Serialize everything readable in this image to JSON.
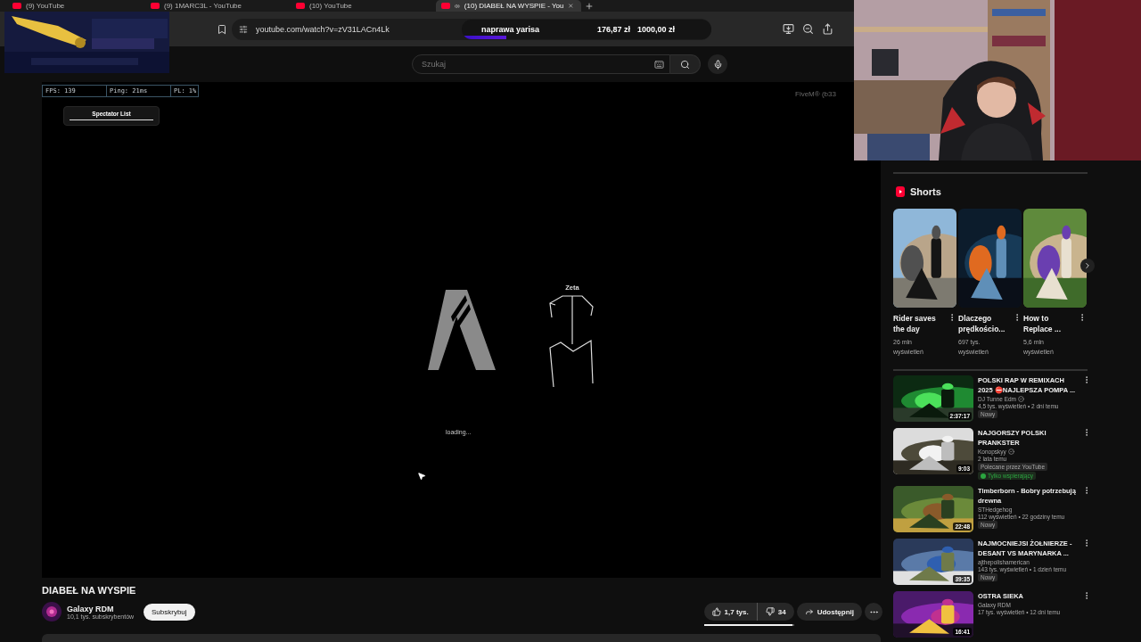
{
  "browser": {
    "tabs": [
      {
        "title": "(9) YouTube",
        "selected": false,
        "audio": false
      },
      {
        "title": "(9) 1MARC3L - YouTube",
        "selected": false,
        "audio": false
      },
      {
        "title": "(10) YouTube",
        "selected": false,
        "audio": false
      },
      {
        "title": "(10) DIABEŁ NA WYSPIE - You",
        "selected": true,
        "audio": true
      }
    ],
    "address": "youtube.com/watch?v=zV31LACn4Lk"
  },
  "stream_goal": {
    "label": "naprawa yarisa",
    "level": 0.18,
    "raised": "176,87 zł",
    "target": "1000,00 zł"
  },
  "search": {
    "placeholder": "Szukaj"
  },
  "player": {
    "hud": [
      "FPS: 139",
      "Ping: 21ms",
      "PL: 1%"
    ],
    "spectator_title": "Spectator List",
    "version": "FiveM® (b33",
    "player_tag": "Zeta",
    "status": "loading..."
  },
  "video": {
    "title": "DIABEŁ NA WYSPIE",
    "channel": "Galaxy RDM",
    "subscribers": "10,1 tys. subskrybentów",
    "subscribe": "Subskrybuj",
    "likes": "1,7 tys.",
    "dislikes": "34",
    "share": "Udostępnij",
    "rating_bar": {
      "level": 0.98
    }
  },
  "shorts": {
    "heading": "Shorts",
    "items": [
      {
        "title": "Rider saves the day",
        "views": "26 mln wyświetleń"
      },
      {
        "title": "Dlaczego prędkościo...",
        "views": "697 tys. wyświetleń"
      },
      {
        "title": "How to Replace ...",
        "views": "5,6 mln wyświetleń"
      }
    ]
  },
  "recommended": [
    {
      "title": "POLSKI RAP W REMIXACH 2025 ⛔NAJLEPSZA POMPA ...",
      "channel": "DJ Tunne Edm",
      "verified": true,
      "meta": "4,5 tys. wyświetleń • 2 dni temu",
      "badges": [
        {
          "text": "Nowy",
          "kind": "label"
        }
      ],
      "duration": "2:37:17"
    },
    {
      "title": "NAJGORSZY POLSKI PRANKSTER",
      "channel": "Konopskyy",
      "verified": true,
      "meta": "2 lata temu",
      "badges": [
        {
          "text": "Polecane przez YouTube",
          "kind": "label"
        },
        {
          "text": "Tylko wspierający",
          "kind": "members"
        }
      ],
      "duration": "9:03"
    },
    {
      "title": "Timberborn - Bobry potrzebują drewna",
      "channel": "STHedgehog",
      "verified": false,
      "meta": "112 wyświetleń • 22 godziny temu",
      "badges": [
        {
          "text": "Nowy",
          "kind": "label"
        }
      ],
      "duration": "22:48"
    },
    {
      "title": "NAJMOCNIEJSI ŻOŁNIERZE - DESANT VS MARYNARKA ...",
      "channel": "ajthepolishamerican",
      "verified": false,
      "meta": "143 tys. wyświetleń • 1 dzień temu",
      "badges": [
        {
          "text": "Nowy",
          "kind": "label"
        }
      ],
      "duration": "39:35"
    },
    {
      "title": "OSTRA SIEKA",
      "channel": "Galaxy RDM",
      "verified": false,
      "meta": "17 tys. wyświetleń • 12 dni temu",
      "duration": "16:41"
    }
  ]
}
